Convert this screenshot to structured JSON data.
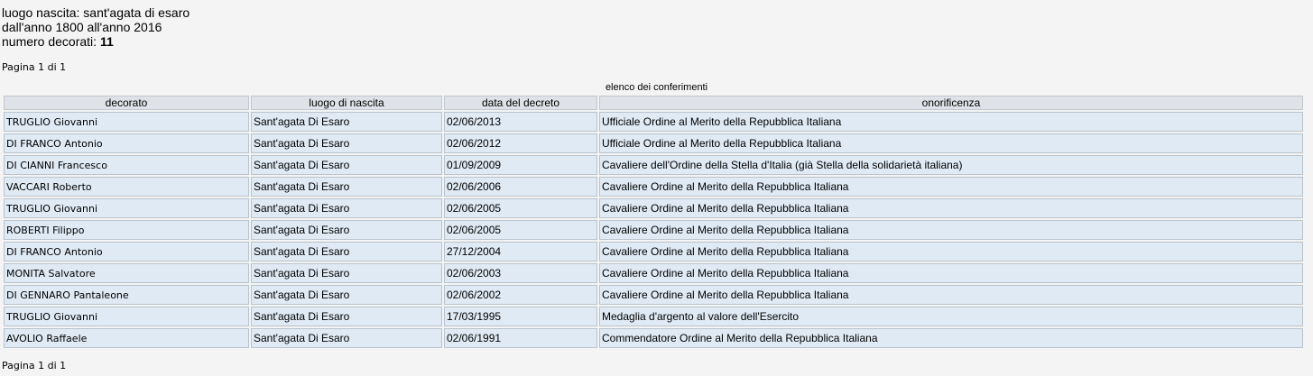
{
  "summary": {
    "place_label": "luogo nascita:",
    "place_value": "sant'agata di esaro",
    "range_text": "dall'anno 1800 all'anno 2016",
    "count_label": "numero decorati:",
    "count_value": "11"
  },
  "pagination": {
    "top": "Pagina 1 di 1",
    "bottom": "Pagina 1 di 1"
  },
  "table": {
    "caption": "elenco dei conferimenti",
    "headers": [
      "decorato",
      "luogo di nascita",
      "data del decreto",
      "onorificenza"
    ],
    "rows": [
      {
        "name": "TRUGLIO Giovanni",
        "place": "Sant'agata Di Esaro",
        "date": "02/06/2013",
        "honor": "Ufficiale Ordine al Merito della Repubblica Italiana"
      },
      {
        "name": "DI FRANCO Antonio",
        "place": "Sant'agata Di Esaro",
        "date": "02/06/2012",
        "honor": "Ufficiale Ordine al Merito della Repubblica Italiana"
      },
      {
        "name": "DI CIANNI Francesco",
        "place": "Sant'agata Di Esaro",
        "date": "01/09/2009",
        "honor": "Cavaliere dell'Ordine della Stella d'Italia (già Stella della solidarietà italiana)"
      },
      {
        "name": "VACCARI Roberto",
        "place": "Sant'agata Di Esaro",
        "date": "02/06/2006",
        "honor": "Cavaliere Ordine al Merito della Repubblica Italiana"
      },
      {
        "name": "TRUGLIO Giovanni",
        "place": "Sant'agata Di Esaro",
        "date": "02/06/2005",
        "honor": "Cavaliere Ordine al Merito della Repubblica Italiana"
      },
      {
        "name": "ROBERTI Filippo",
        "place": "Sant'agata Di Esaro",
        "date": "02/06/2005",
        "honor": "Cavaliere Ordine al Merito della Repubblica Italiana"
      },
      {
        "name": "DI FRANCO Antonio",
        "place": "Sant'agata Di Esaro",
        "date": "27/12/2004",
        "honor": "Cavaliere Ordine al Merito della Repubblica Italiana"
      },
      {
        "name": "MONITA Salvatore",
        "place": "Sant'agata Di Esaro",
        "date": "02/06/2003",
        "honor": "Cavaliere Ordine al Merito della Repubblica Italiana"
      },
      {
        "name": "DI GENNARO Pantaleone",
        "place": "Sant'agata Di Esaro",
        "date": "02/06/2002",
        "honor": "Cavaliere Ordine al Merito della Repubblica Italiana"
      },
      {
        "name": "TRUGLIO Giovanni",
        "place": "Sant'agata Di Esaro",
        "date": "17/03/1995",
        "honor": "Medaglia d'argento al valore dell'Esercito"
      },
      {
        "name": "AVOLIO Raffaele",
        "place": "Sant'agata Di Esaro",
        "date": "02/06/1991",
        "honor": "Commendatore Ordine al Merito della Repubblica Italiana"
      }
    ]
  },
  "colors": {
    "page_background": "#f4f4f4",
    "header_background": "#dfe3e8",
    "cell_background": "#dfeaf5",
    "cell_border": "#b9c3cd"
  }
}
